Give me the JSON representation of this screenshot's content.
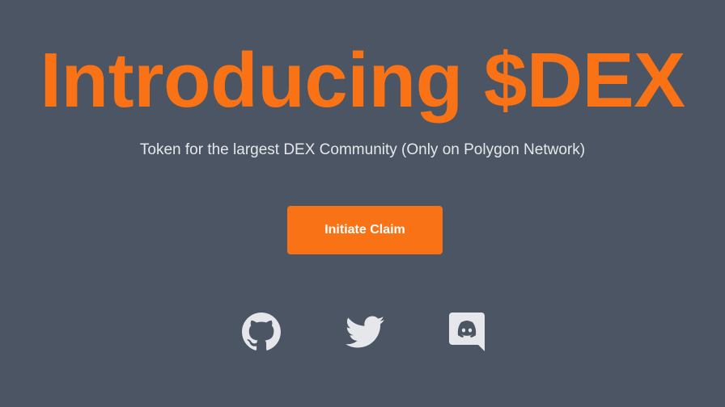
{
  "hero": {
    "title": "Introducing $DEX",
    "subtitle": "Token for the largest DEX Community (Only on Polygon Network)"
  },
  "cta": {
    "label": "Initiate Claim"
  },
  "social": [
    {
      "name": "GitHub",
      "icon": "github-icon"
    },
    {
      "name": "Twitter",
      "icon": "twitter-icon"
    },
    {
      "name": "Discord",
      "icon": "discord-icon"
    }
  ],
  "colors": {
    "background": "#4b5563",
    "accent": "#f97316",
    "text": "#e5e7eb",
    "icon": "#e5e7eb"
  }
}
